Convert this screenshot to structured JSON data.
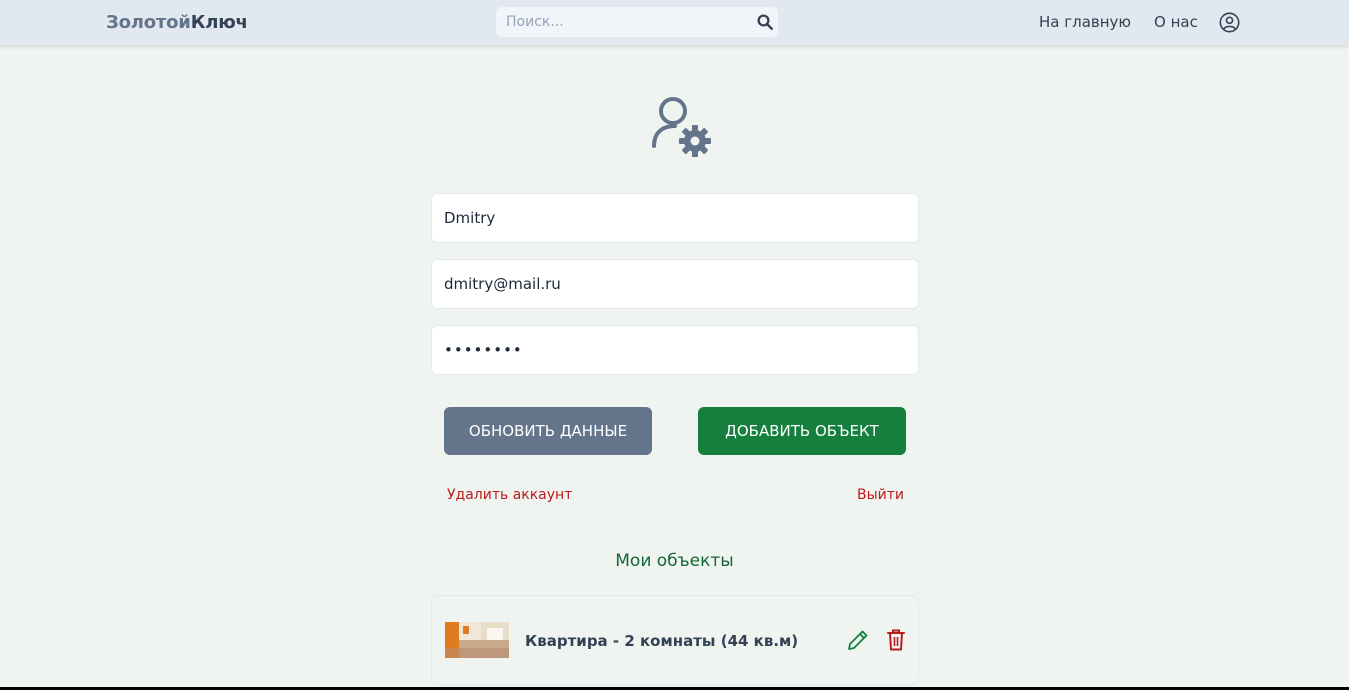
{
  "header": {
    "logo_part1": "Золотой",
    "logo_part2": "Ключ",
    "search_placeholder": "Поиск...",
    "nav_home": "На главную",
    "nav_about": "О нас"
  },
  "profile": {
    "name": "Dmitry",
    "email": "dmitry@mail.ru",
    "password": "••••••••"
  },
  "actions": {
    "update_label": "ОБНОВИТЬ ДАННЫЕ",
    "add_label": "ДОБАВИТЬ ОБЪЕКТ",
    "delete_account_label": "Удалить аккаунт",
    "logout_label": "Выйти"
  },
  "objects": {
    "title": "Мои объекты",
    "items": [
      {
        "title": "Квартира - 2 комнаты (44 кв.м)"
      }
    ]
  },
  "colors": {
    "brand_green": "#15803d",
    "slate": "#64748b",
    "danger": "#b91c1c"
  },
  "icons": [
    "search-icon",
    "user-circle-icon",
    "user-gear-icon",
    "pencil-icon",
    "trash-icon"
  ]
}
